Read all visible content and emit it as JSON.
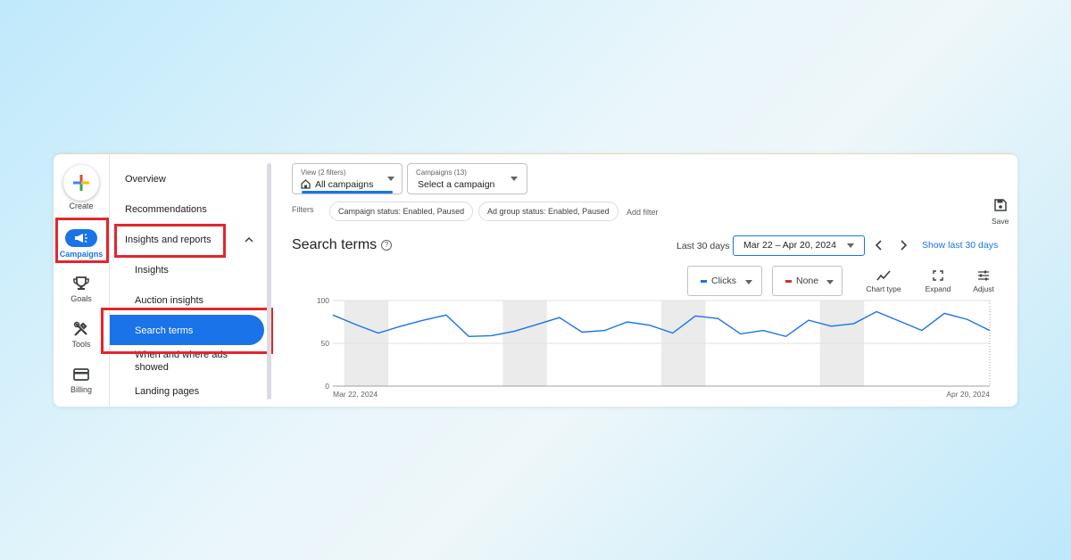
{
  "rail": {
    "create": "Create",
    "campaigns": "Campaigns",
    "goals": "Goals",
    "tools": "Tools",
    "billing": "Billing"
  },
  "nav": {
    "overview": "Overview",
    "recommendations": "Recommendations",
    "insights_reports": "Insights and reports",
    "insights": "Insights",
    "auction_insights": "Auction insights",
    "search_terms": "Search terms",
    "when_where_1": "When and where ads",
    "when_where_2": "showed",
    "landing_pages": "Landing pages"
  },
  "toolbar": {
    "view_label": "View (2 filters)",
    "view_value": "All campaigns",
    "campaigns_label": "Campaigns (13)",
    "campaigns_value": "Select a campaign",
    "filters_label": "Filters",
    "filter_chips": [
      "Campaign status: Enabled, Paused",
      "Ad group status: Enabled, Paused"
    ],
    "add_filter": "Add filter",
    "save": "Save"
  },
  "report": {
    "title": "Search terms",
    "range_label": "Last 30 days",
    "date_range": "Mar 22 – Apr 20, 2024",
    "show_last": "Show last 30 days"
  },
  "controls": {
    "metric1": "Clicks",
    "metric1_color": "#1a73e8",
    "metric2": "None",
    "metric2_color": "#d93025",
    "chart_type": "Chart type",
    "expand": "Expand",
    "adjust": "Adjust"
  },
  "chart_data": {
    "type": "line",
    "x_start_label": "Mar 22, 2024",
    "x_end_label": "Apr 20, 2024",
    "ylim": [
      0,
      100
    ],
    "y_ticks": [
      "0",
      "50",
      "100"
    ],
    "series": [
      {
        "name": "Clicks",
        "color": "#1a73e8",
        "values": [
          83,
          72,
          62,
          70,
          77,
          83,
          58,
          59,
          64,
          72,
          80,
          63,
          65,
          75,
          71,
          62,
          82,
          79,
          61,
          65,
          58,
          77,
          70,
          73,
          87,
          76,
          65,
          85,
          78,
          65
        ]
      }
    ],
    "weekend_bands": [
      [
        1,
        2
      ],
      [
        8,
        9
      ],
      [
        15,
        16
      ],
      [
        22,
        23
      ]
    ]
  }
}
